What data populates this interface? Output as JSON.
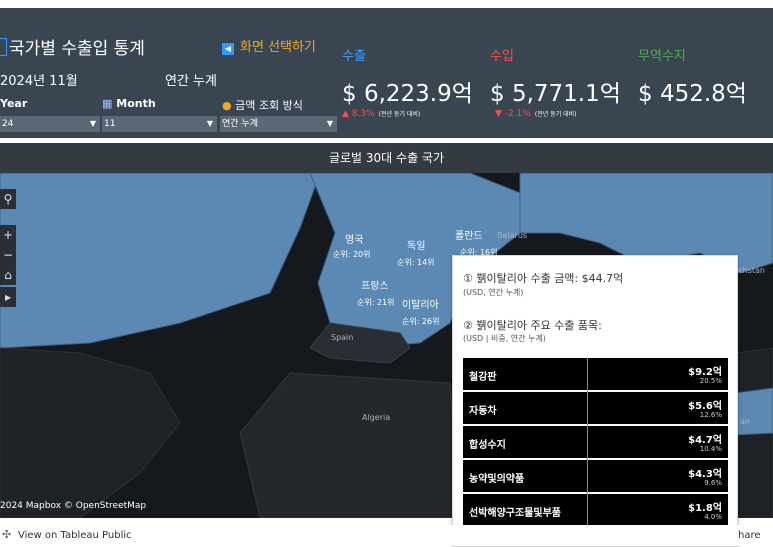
{
  "header": {
    "title": "국가별 수출입 통계",
    "select_screen": "화면 선택하기",
    "period": "2024년 11월",
    "cumulative": "연간 누계"
  },
  "filters": {
    "year_label": "Year",
    "year_value": "24",
    "month_label": "Month",
    "month_value": "11",
    "method_label": "금액 조회 방식",
    "method_value": "연간 누계"
  },
  "metrics": {
    "export": {
      "label": "수출",
      "value": "$ 6,223.9억",
      "change": "▲ 8.3%",
      "note": "(전년 동기 대비)"
    },
    "import": {
      "label": "수입",
      "value": "$ 5,771.1억",
      "change": "▼ -2.1%",
      "note": "(전년 동기 대비)"
    },
    "balance": {
      "label": "무역수지",
      "value": "$ 452.8억"
    }
  },
  "map": {
    "title": "글로벌 30대 수출 국가",
    "copyright": "2024 Mapbox © OpenStreetMap",
    "countries": [
      {
        "name": "영국",
        "rank": "순위: 20위"
      },
      {
        "name": "독일",
        "rank": "순위: 14위"
      },
      {
        "name": "폴란드",
        "rank": "순위: 16위"
      },
      {
        "name": "프랑스",
        "rank": "순위: 21위"
      },
      {
        "name": "이탈리아",
        "rank": "순위: 26위"
      }
    ],
    "other_labels": [
      "Belarus",
      "Spain",
      "Algeria",
      "khstan",
      "an"
    ]
  },
  "tooltip": {
    "line1": "① 뷁이탈리아 수출 금액: $44.7억",
    "sub1": "(USD, 연간 누계)",
    "line2": "② 뷁이탈리아 주요 수출 품목:",
    "sub2": "(USD | 비중, 연간 누계)",
    "items": [
      {
        "name": "철강판",
        "amount": "$9.2억",
        "pct": "20.5%"
      },
      {
        "name": "자동차",
        "amount": "$5.6억",
        "pct": "12.6%"
      },
      {
        "name": "합성수지",
        "amount": "$4.7억",
        "pct": "10.4%"
      },
      {
        "name": "농약및의약품",
        "amount": "$4.3억",
        "pct": "9.6%"
      },
      {
        "name": "선박해양구조물및부품",
        "amount": "$1.8억",
        "pct": "4.0%"
      }
    ]
  },
  "footer": {
    "link": "View on Tableau Public",
    "share": "hare"
  },
  "colors": {
    "header_bg": "#3a4552",
    "accent_orange": "#f5a623",
    "accent_blue": "#2b9bff",
    "export_label": "#3aa0ff",
    "import_label": "#ff4d4d",
    "balance_label": "#4caf50",
    "increase": "#ff4d4d",
    "decrease": "#ff4d4d",
    "map_highlight": "#5b89b3"
  }
}
